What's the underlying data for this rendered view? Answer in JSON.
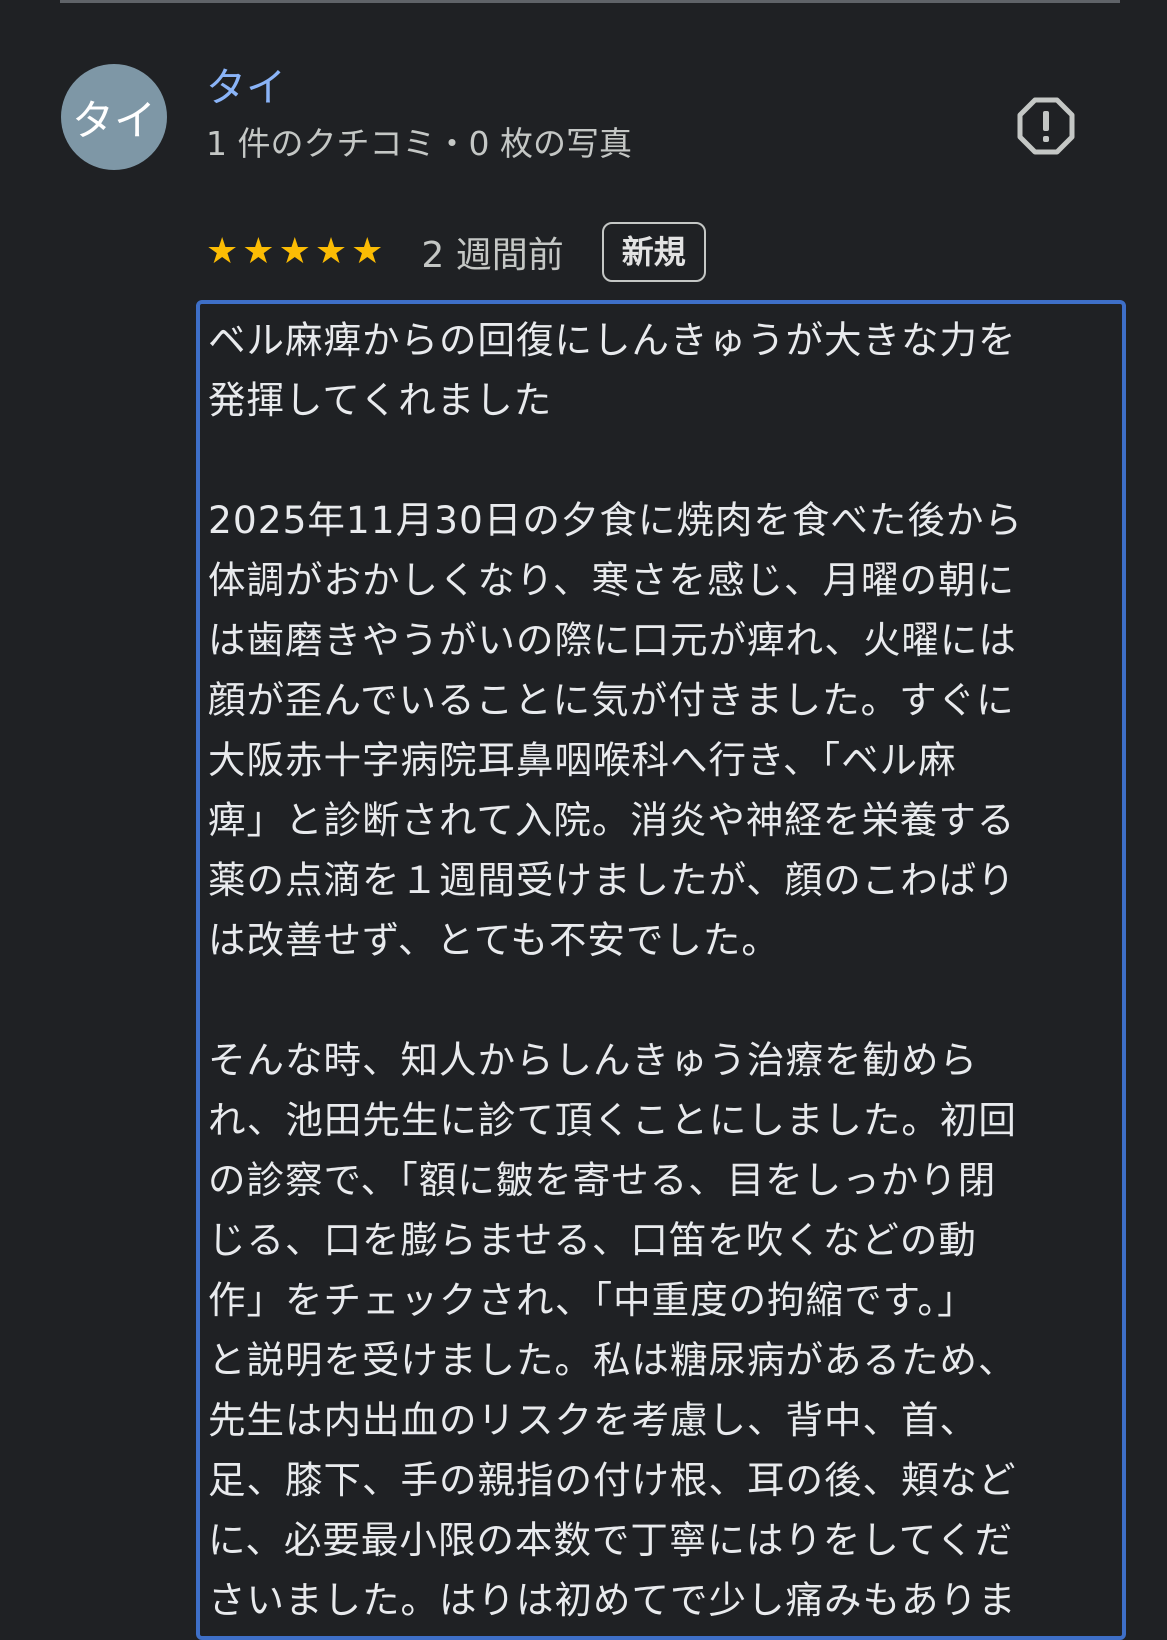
{
  "reviewer": {
    "avatar_text": "タイ",
    "name": "タイ",
    "meta": "1 件のクチコミ・0 枚の写真"
  },
  "actions": {
    "report_icon": "report-flag-icon"
  },
  "rating": {
    "stars": 5,
    "max_stars": 5,
    "time_ago": "2 週間前",
    "badge": "新規"
  },
  "review": {
    "line_01": "ベル麻痺からの回復にしんきゅうが大きな力を",
    "line_02": "発揮してくれました",
    "line_03": "",
    "line_04": "2025年11月30日の夕食に焼肉を食べた後から",
    "line_05": "体調がおかしくなり、寒さを感じ、月曜の朝に",
    "line_06": "は歯磨きやうがいの際に口元が痺れ、火曜には",
    "line_07": "顔が歪んでいることに気が付きました。すぐに",
    "line_08": "大阪赤十字病院耳鼻咽喉科へ行き、「ベル麻",
    "line_09": "痺」と診断されて入院。消炎や神経を栄養する",
    "line_10": "薬の点滴を１週間受けましたが、顔のこわばり",
    "line_11": "は改善せず、とても不安でした。",
    "line_12": "",
    "line_13": "そんな時、知人からしんきゅう治療を勧めら",
    "line_14": "れ、池田先生に診て頂くことにしました。初回",
    "line_15": "の診察で、「額に皺を寄せる、目をしっかり閉",
    "line_16": "じる、口を膨らませる、口笛を吹くなどの動",
    "line_17": "作」をチェックされ、「中重度の拘縮です。」",
    "line_18": "と説明を受けました。私は糖尿病があるため、",
    "line_19": "先生は内出血のリスクを考慮し、背中、首、",
    "line_20": "足、膝下、手の親指の付け根、耳の後、頬など",
    "line_21": "に、必要最小限の本数で丁寧にはりをしてくだ",
    "line_22": "さいました。はりは初めてで少し痛みもありま"
  },
  "colors": {
    "background": "#1f2124",
    "name_link": "#8ab4f8",
    "star": "#fbbc04",
    "focus_border": "#3e6fc7"
  }
}
